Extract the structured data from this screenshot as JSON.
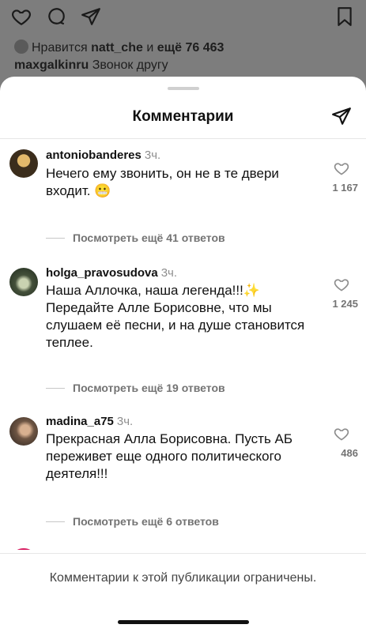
{
  "post": {
    "likes_prefix": "Нравится",
    "likes_user": "natt_che",
    "likes_mid": "и",
    "likes_rest": "ещё 76 463",
    "caption_user": "maxgalkinru",
    "caption_text": "Звонок другу"
  },
  "sheet": {
    "title": "Комментарии"
  },
  "comments": [
    {
      "user": "antoniobanderes",
      "time": "3ч.",
      "text": "Нечего ему звонить, он не в те двери входит. 😬",
      "likes": "1 167",
      "replies": "Посмотреть ещё 41 ответов"
    },
    {
      "user": "holga_pravosudova",
      "time": "3ч.",
      "text": "Наша Аллочка, наша легенда!!!✨ Передайте Алле Борисовне, что мы слушаем её песни, и на душе становится теплее.",
      "likes": "1 245",
      "replies": "Посмотреть ещё 19 ответов"
    },
    {
      "user": "madina_a75",
      "time": "3ч.",
      "text": "Прекрасная Алла Борисовна. Пусть АБ переживет еще одного политического деятеля!!!",
      "likes": "486",
      "replies": "Посмотреть ещё 6 ответов"
    }
  ],
  "footer": {
    "notice": "Комментарии к этой публикации ограничены."
  }
}
